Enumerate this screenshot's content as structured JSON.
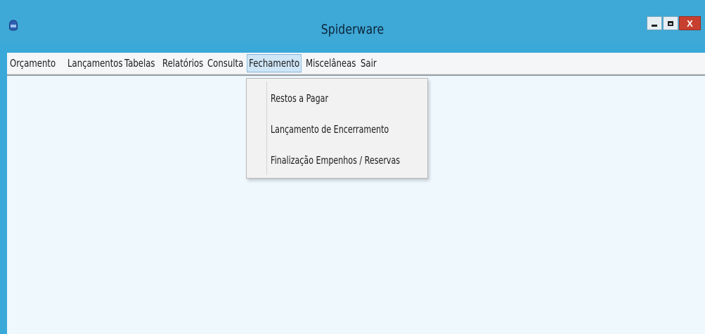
{
  "window": {
    "title": "Spiderware",
    "controls": {
      "minimize": "minimize",
      "maximize": "maximize",
      "close_label": "X"
    }
  },
  "menu": {
    "items": [
      {
        "label": "Orçamento"
      },
      {
        "label": "Lançamentos"
      },
      {
        "label": "Tabelas"
      },
      {
        "label": "Relatórios"
      },
      {
        "label": "Consulta"
      },
      {
        "label": "Fechamento"
      },
      {
        "label": "Miscelâneas"
      },
      {
        "label": "Sair"
      }
    ],
    "active": "Fechamento"
  },
  "dropdown": {
    "items": [
      {
        "label": "Restos a Pagar"
      },
      {
        "label": "Lançamento de Encerramento"
      },
      {
        "label": "Finalização Empenhos / Reservas"
      }
    ]
  },
  "colors": {
    "titlebar": "#3ea8d6",
    "client_background": "#eef8fd",
    "close_button": "#c7402f"
  },
  "icons": [
    "app-icon",
    "minimize-icon",
    "maximize-icon",
    "close-icon"
  ]
}
